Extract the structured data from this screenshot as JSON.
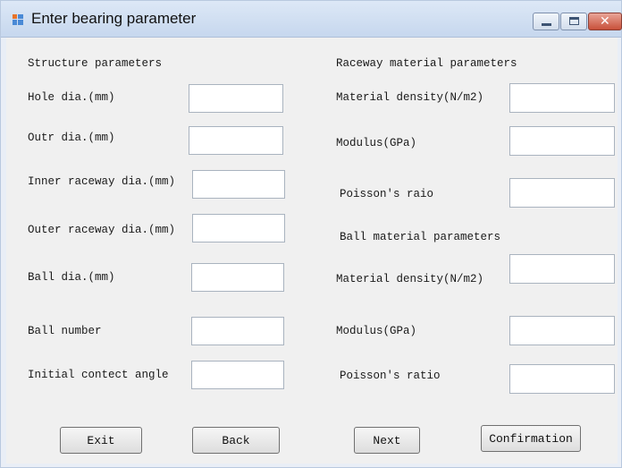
{
  "window": {
    "title": "Enter bearing parameter",
    "icon": "app-form-icon",
    "controls": {
      "minimize": "minimize-icon",
      "maximize": "maximize-icon",
      "close": "close-icon"
    }
  },
  "structure": {
    "heading": "Structure parameters",
    "fields": [
      {
        "label": "Hole dia.(mm)",
        "value": ""
      },
      {
        "label": "Outr dia.(mm)",
        "value": ""
      },
      {
        "label": "Inner raceway dia.(mm)",
        "value": ""
      },
      {
        "label": "Outer raceway dia.(mm)",
        "value": ""
      },
      {
        "label": "Ball dia.(mm)",
        "value": ""
      },
      {
        "label": "Ball number",
        "value": ""
      },
      {
        "label": "Initial contect angle",
        "value": ""
      }
    ]
  },
  "raceway": {
    "heading": "Raceway material parameters",
    "fields": [
      {
        "label": "Material density(N/m2)",
        "value": ""
      },
      {
        "label": "Modulus(GPa)",
        "value": ""
      },
      {
        "label": "Poisson's raio",
        "value": ""
      }
    ]
  },
  "ball": {
    "heading": "Ball material parameters",
    "fields": [
      {
        "label": "Material density(N/m2)",
        "value": ""
      },
      {
        "label": "Modulus(GPa)",
        "value": ""
      },
      {
        "label": "Poisson's ratio",
        "value": ""
      }
    ]
  },
  "buttons": {
    "exit": "Exit",
    "back": "Back",
    "next": "Next",
    "confirmation": "Confirmation"
  }
}
